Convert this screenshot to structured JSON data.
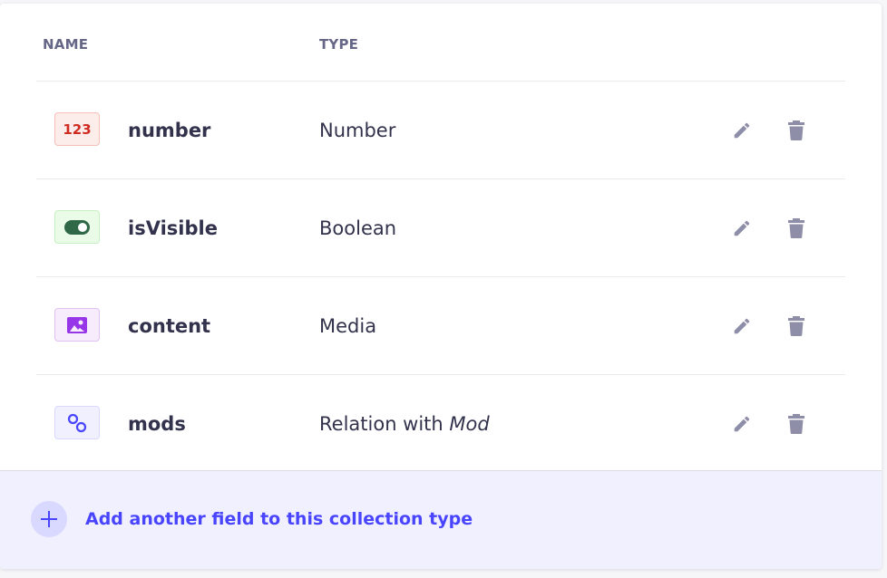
{
  "table": {
    "headers": {
      "name": "NAME",
      "type": "TYPE"
    },
    "rows": [
      {
        "icon": "number-icon",
        "icon_text": "123",
        "name": "number",
        "type": "Number",
        "type_target": ""
      },
      {
        "icon": "toggle-icon",
        "name": "isVisible",
        "type": "Boolean",
        "type_target": ""
      },
      {
        "icon": "image-icon",
        "name": "content",
        "type": "Media",
        "type_target": ""
      },
      {
        "icon": "link-icon",
        "name": "mods",
        "type": "Relation with ",
        "type_target": "Mod"
      }
    ]
  },
  "footer": {
    "add_label": "Add another field to this collection type"
  },
  "colors": {
    "accent": "#4945ff",
    "text": "#32324d",
    "muted": "#666687",
    "action_icon": "#8e8ea9"
  }
}
